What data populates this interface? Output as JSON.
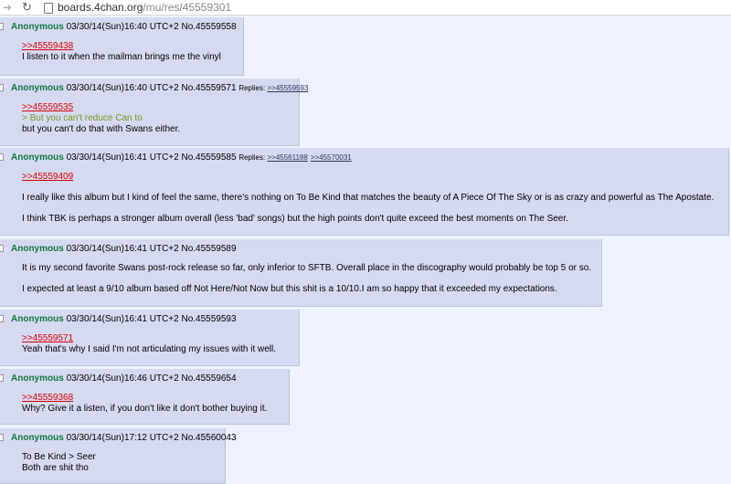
{
  "browser": {
    "url_host": "boards.4chan.org",
    "url_path": "/mu/res/45559301"
  },
  "posts": [
    {
      "name": "Anonymous",
      "datetime": "03/30/14(Sun)16:40 UTC+2",
      "no": "No.45559558",
      "replies_label": "",
      "replies": [],
      "quote": ">>45559438",
      "greentext": "",
      "lines": [
        "I listen to it when the mailman brings me the vinyl"
      ]
    },
    {
      "name": "Anonymous",
      "datetime": "03/30/14(Sun)16:40 UTC+2",
      "no": "No.45559571",
      "replies_label": "Replies:",
      "replies": [
        ">>45559593"
      ],
      "quote": ">>45559535",
      "greentext": "> But you can't reduce Can to",
      "lines": [
        "but you can't do that with Swans either."
      ]
    },
    {
      "name": "Anonymous",
      "datetime": "03/30/14(Sun)16:41 UTC+2",
      "no": "No.45559585",
      "replies_label": "Replies:",
      "replies": [
        ">>45561188",
        ">>45570031"
      ],
      "quote": ">>45559409",
      "greentext": "",
      "lines": [
        "I really like this album but I kind of feel the same, there's nothing on To Be Kind that matches the beauty of A Piece Of The Sky or is as crazy and powerful as The Apostate.",
        "I think TBK is perhaps a stronger album overall (less 'bad' songs) but the high points don't quite exceed the best moments on The Seer."
      ]
    },
    {
      "name": "Anonymous",
      "datetime": "03/30/14(Sun)16:41 UTC+2",
      "no": "No.45559589",
      "replies_label": "",
      "replies": [],
      "quote": "",
      "greentext": "",
      "lines": [
        "It is my second favorite Swans post-rock release so far, only inferior to SFTB. Overall place in the discography would probably be top 5 or so.",
        "I expected at least a 9/10 album based off Not Here/Not Now but this shit is a 10/10.I am so happy that it exceeded my expectations."
      ]
    },
    {
      "name": "Anonymous",
      "datetime": "03/30/14(Sun)16:41 UTC+2",
      "no": "No.45559593",
      "replies_label": "",
      "replies": [],
      "quote": ">>45559571",
      "greentext": "",
      "lines": [
        "Yeah that's why I said I'm not articulating my issues with it well."
      ]
    },
    {
      "name": "Anonymous",
      "datetime": "03/30/14(Sun)16:46 UTC+2",
      "no": "No.45559654",
      "replies_label": "",
      "replies": [],
      "quote": ">>45559368",
      "greentext": "",
      "lines": [
        "Why? Give it a listen, if you don't like it don't bother buying it."
      ]
    },
    {
      "name": "Anonymous",
      "datetime": "03/30/14(Sun)17:12 UTC+2",
      "no": "No.45560043",
      "replies_label": "",
      "replies": [],
      "quote": "",
      "greentext": "",
      "lines": [
        "To Be Kind > Seer",
        "Both are shit tho"
      ]
    }
  ]
}
